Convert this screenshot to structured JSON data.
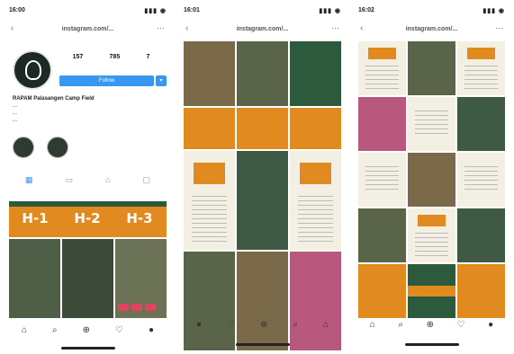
{
  "colors": {
    "accent_blue": "#3897f0",
    "orange": "#e08a1f",
    "forest_green": "#2d5a3c",
    "pink": "#b7587c"
  },
  "phones": [
    {
      "time": "16:00",
      "signal": "▮▮▮ ◉",
      "url": "instagram.com/...",
      "back_icon": "chevron-left-icon",
      "more_icon": "more-icon"
    },
    {
      "time": "16:01",
      "signal": "▮▮▮ ◉",
      "url": "instagram.com/...",
      "back_icon": "chevron-left-icon",
      "more_icon": "more-icon"
    },
    {
      "time": "16:02",
      "signal": "▮▮▮ ◉",
      "url": "instagram.com/...",
      "back_icon": "chevron-left-icon",
      "more_icon": "more-icon"
    }
  ],
  "profile": {
    "stats": [
      {
        "value": "157"
      },
      {
        "value": "785"
      },
      {
        "value": "7"
      }
    ],
    "follow_label": "Follow",
    "name": "RAPAM Palasangen Camp Field",
    "bio_lines": [
      "...",
      "...",
      "..."
    ],
    "highlights": [
      {
        "label": ""
      },
      {
        "label": ""
      }
    ],
    "banner": [
      "H-1",
      "H-2",
      "H-3"
    ]
  },
  "icons": {
    "tabs": [
      "grid-icon",
      "tv-icon",
      "tag-icon",
      "user-tag-icon"
    ],
    "bottom_nav": [
      "home-icon",
      "search-icon",
      "add-icon",
      "heart-icon",
      "profile-icon"
    ]
  }
}
